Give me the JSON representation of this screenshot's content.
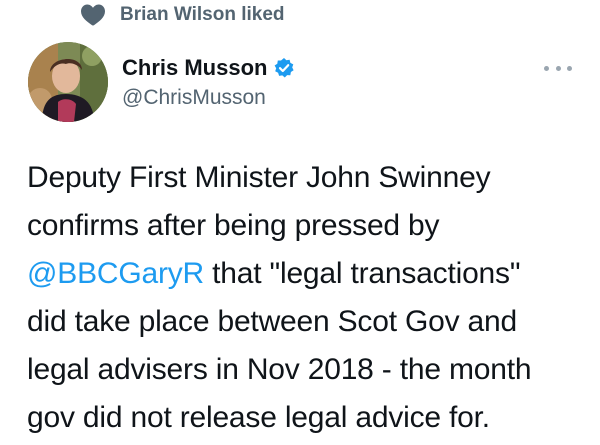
{
  "social_context": {
    "icon": "heart-icon",
    "text": "Brian Wilson liked"
  },
  "author": {
    "avatar": "avatar",
    "display_name": "Chris Musson",
    "verified_icon": "verified-badge-icon",
    "handle": "@ChrisMusson"
  },
  "more_icon": "more-horizontal-icon",
  "tweet": {
    "text_before": "Deputy First Minister John Swinney\nconfirms after being pressed by\n",
    "mention": "@BBCGaryR",
    "text_after": " that \"legal transactions\"\ndid take place between Scot Gov and\nlegal advisers in Nov 2018 - the month\ngov did not release legal advice for."
  },
  "colors": {
    "accent": "#1d9bf0",
    "secondary_text": "#536471",
    "primary_text": "#0f1419"
  }
}
